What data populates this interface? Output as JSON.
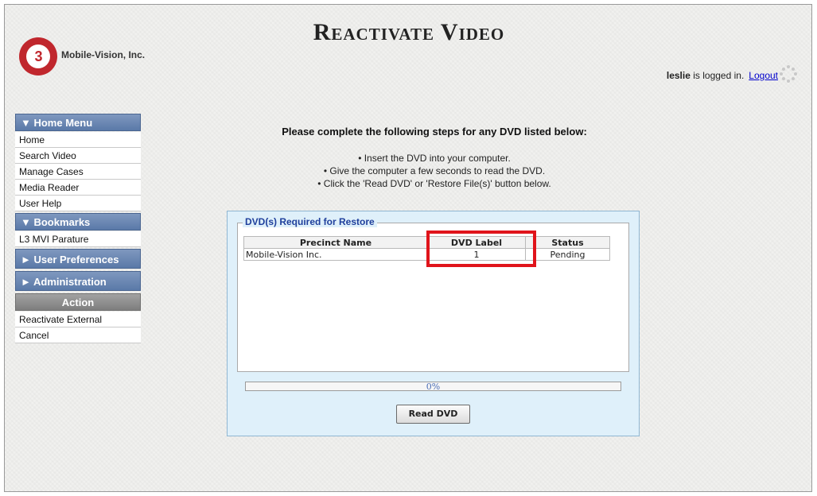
{
  "header": {
    "title": "Reactivate Video",
    "logo_text": "Mobile-Vision, Inc.",
    "logo_mark": "3",
    "username": "leslie",
    "logged_in_text": " is logged in.",
    "logout_label": "Logout"
  },
  "sidebar": {
    "home_menu": {
      "title": "▼  Home Menu",
      "items": [
        "Home",
        "Search Video",
        "Manage Cases",
        "Media Reader",
        "User Help"
      ]
    },
    "bookmarks": {
      "title": "▼  Bookmarks",
      "items": [
        "L3 MVI Parature"
      ]
    },
    "user_preferences": {
      "title": "►  User Preferences"
    },
    "administration": {
      "title": "►  Administration"
    },
    "action": {
      "title": "Action",
      "items": [
        "Reactivate External",
        "Cancel"
      ]
    }
  },
  "instructions": {
    "title": "Please complete the following steps for any DVD listed below:",
    "steps": [
      "• Insert the DVD into your computer.",
      "• Give the computer a few seconds to read the DVD.",
      "• Click the 'Read DVD' or 'Restore File(s)' button below."
    ]
  },
  "restore_panel": {
    "legend": "DVD(s) Required for Restore",
    "columns": [
      "Precinct Name",
      "DVD Label",
      "Status"
    ],
    "rows": [
      [
        "Mobile-Vision Inc.",
        "1",
        "Pending"
      ]
    ],
    "progress": {
      "value": 0,
      "text": "0%"
    },
    "read_button": "Read DVD"
  },
  "colors": {
    "menu_header": "#5a79a8",
    "action_header": "#7e7e7e",
    "panel_bg": "#dff0fa",
    "highlight": "#e0141b",
    "link": "#0000cc"
  }
}
